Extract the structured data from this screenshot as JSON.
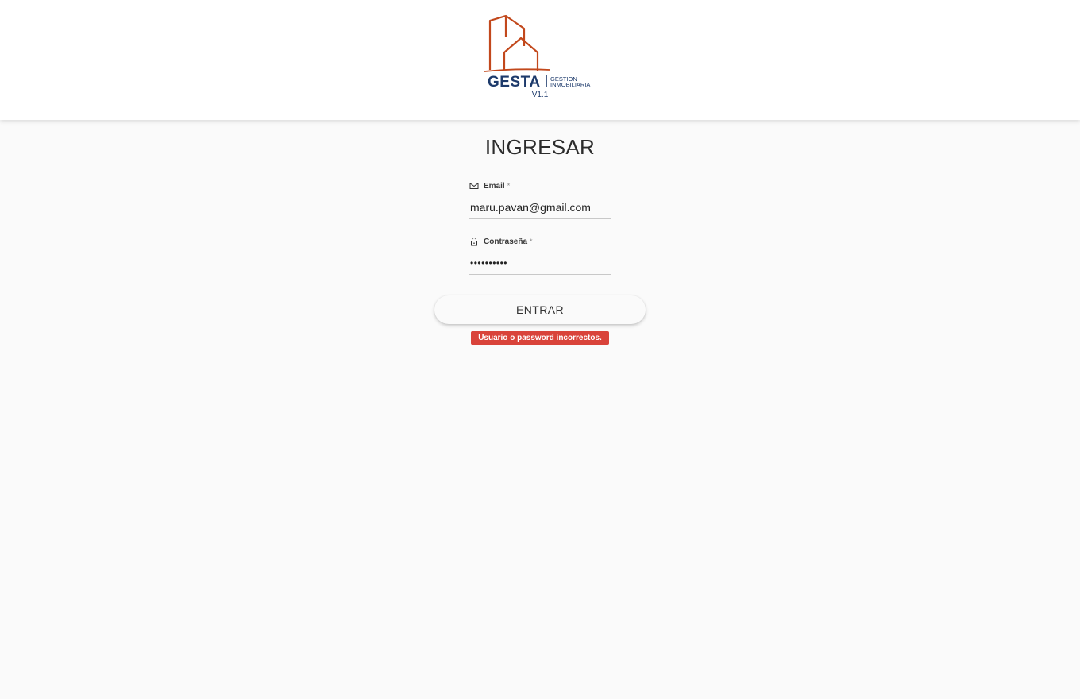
{
  "brand": {
    "name": "GESTA",
    "tagline_line1": "GESTION",
    "tagline_line2": "INMOBILIARIA",
    "version": "V1.1",
    "colors": {
      "building": "#c2481c",
      "wordmark": "#1d3a6b"
    }
  },
  "login": {
    "title": "INGRESAR",
    "email": {
      "label": "Email",
      "required_mark": "*",
      "value": "maru.pavan@gmail.com",
      "icon": "envelope-icon"
    },
    "password": {
      "label": "Contraseña",
      "required_mark": "*",
      "value": "••••••••••",
      "icon": "lock-icon"
    },
    "submit_label": "ENTRAR",
    "error_message": "Usuario o password incorrectos.",
    "error_color": "#d9433a"
  }
}
